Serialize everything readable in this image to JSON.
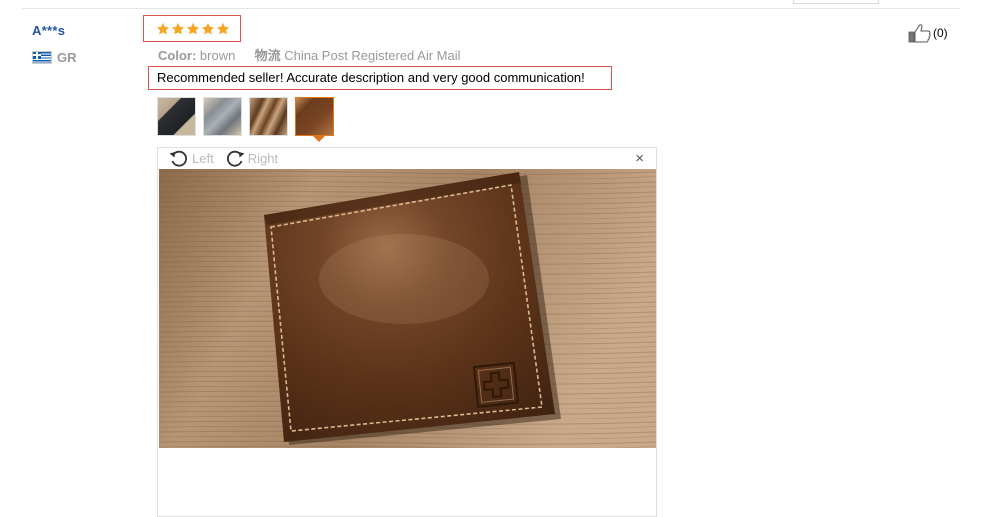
{
  "review": {
    "reviewer_name": "A***s",
    "country_code": "GR",
    "rating": 5,
    "color_label": "Color:",
    "color_value": "brown",
    "shipping_label": "物流",
    "shipping_value": "China Post Registered Air Mail",
    "feedback_text": "Recommended seller! Accurate description and very good communication!",
    "helpful_count": "(0)"
  },
  "photos": {
    "thumbnails": [
      "wallet-photo-1",
      "wallet-photo-2",
      "wallet-photo-3",
      "wallet-photo-4"
    ],
    "selected_index": 3
  },
  "viewer": {
    "rotate_left_label": "Left",
    "rotate_right_label": "Right",
    "close_symbol": "×"
  },
  "icons": {
    "star": "star-icon",
    "flag": "greece-flag-icon",
    "thumbs_up": "thumbs-up-icon",
    "rotate_left": "rotate-left-icon",
    "rotate_right": "rotate-right-icon",
    "close": "close-icon"
  },
  "colors": {
    "star": "#f5a623",
    "highlight_border": "#d9534f",
    "name_link": "#2255a4",
    "selected_thumb": "#e1761a",
    "wallet_brown": "#6b3f22"
  }
}
